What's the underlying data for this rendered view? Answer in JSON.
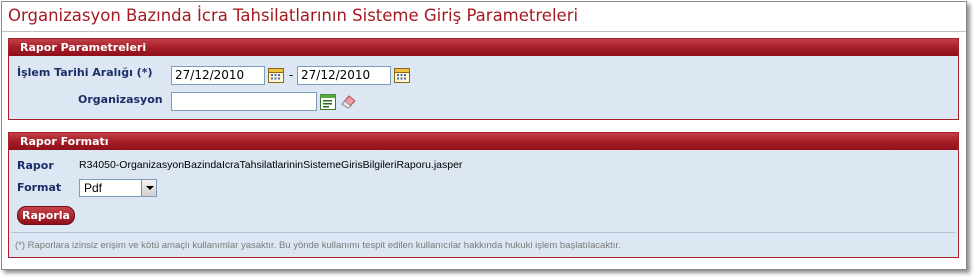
{
  "page": {
    "title": "Organizasyon Bazında İcra Tahsilatlarının Sisteme Giriş Parametreleri"
  },
  "report_params": {
    "header": "Rapor Parametreleri",
    "date_range_label": "İşlem Tarihi Aralığı (*)",
    "start_date": "27/12/2010",
    "separator": "-",
    "end_date": "27/12/2010",
    "organization_label": "Organizasyon",
    "organization_value": ""
  },
  "report_format": {
    "header": "Rapor Formatı",
    "report_label": "Rapor",
    "report_file": "R34050-OrganizasyonBazindaIcraTahsilatlarininSistemeGirisBilgileriRaporu.jasper",
    "format_label": "Format",
    "format_value": "Pdf",
    "submit_label": "Raporla",
    "footnote": "(*) Raporlara izinsiz erişim ve kötü amaçlı kullanımlar yasaktır. Bu yönde kullanımı tespit edilen kullanıcılar hakkında hukuki işlem başlatılacaktır."
  },
  "icons": [
    "calendar-icon",
    "list-icon",
    "eraser-icon",
    "chevron-down-icon"
  ]
}
